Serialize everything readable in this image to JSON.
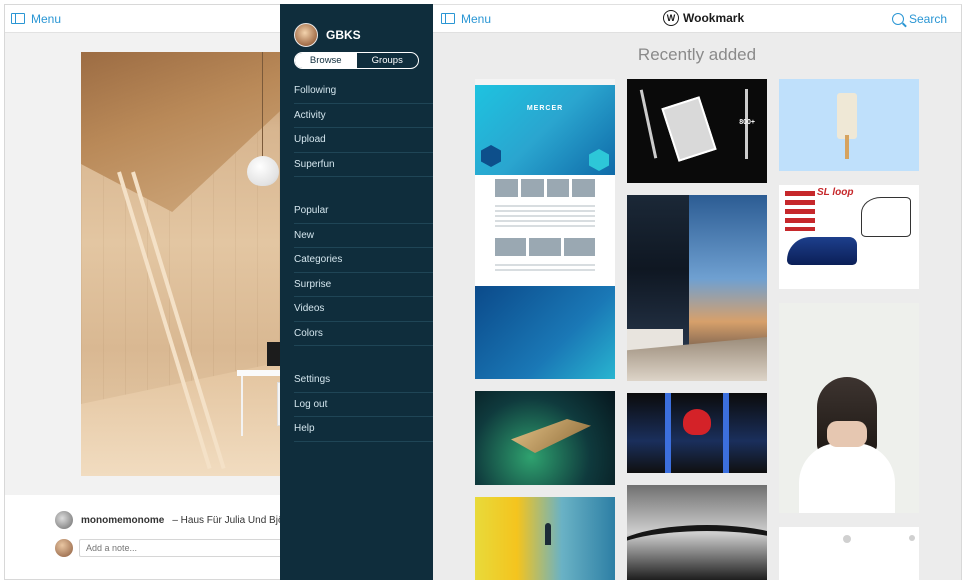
{
  "back_window": {
    "menu_label": "Menu",
    "credit_user": "monomemonome",
    "credit_text": "– Haus Für Julia Und Björn // Innau",
    "note_placeholder": "Add a note..."
  },
  "sidebar": {
    "user_name": "GBKS",
    "toggle": {
      "browse": "Browse",
      "groups": "Groups",
      "selected": "Browse"
    },
    "group1": [
      "Following",
      "Activity",
      "Upload",
      "Superfun"
    ],
    "group2": [
      "Popular",
      "New",
      "Categories",
      "Surprise",
      "Videos",
      "Colors"
    ],
    "group3": [
      "Settings",
      "Log out",
      "Help"
    ]
  },
  "main": {
    "menu_label": "Menu",
    "brand": "Wookmark",
    "brand_logo_letter": "W",
    "search_label": "Search",
    "section_title": "Recently added"
  },
  "thumb_texts": {
    "mercer_title": "MERCER",
    "pen_label": "800+",
    "shoe_label": "SL loop"
  },
  "colors": {
    "accent": "#2a96d4",
    "sidebar_bg": "#0f2d3c"
  }
}
